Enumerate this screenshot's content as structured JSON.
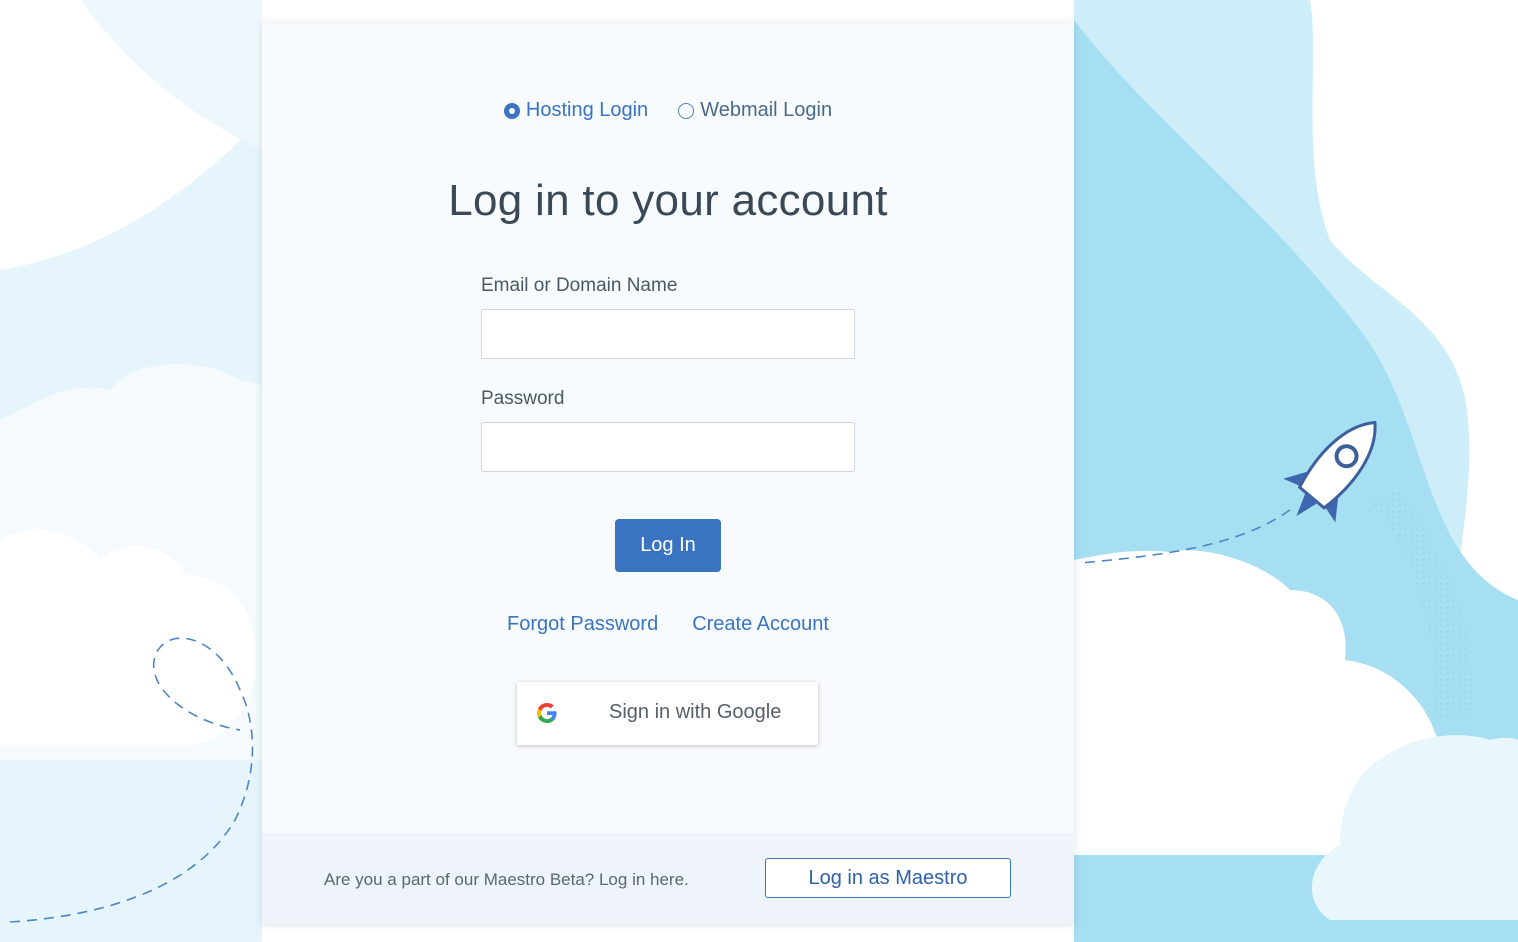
{
  "login_type": {
    "options": [
      {
        "label": "Hosting Login",
        "selected": true
      },
      {
        "label": "Webmail Login",
        "selected": false
      }
    ]
  },
  "form": {
    "title": "Log in to your account",
    "email_label": "Email or Domain Name",
    "email_value": "",
    "password_label": "Password",
    "password_value": "",
    "submit_label": "Log In"
  },
  "links": {
    "forgot_password": "Forgot Password",
    "create_account": "Create Account"
  },
  "google": {
    "label": "Sign in with Google",
    "icon": "google-g-icon"
  },
  "footer": {
    "prompt": "Are you a part of our Maestro Beta? Log in here.",
    "button_label": "Log in as Maestro"
  },
  "colors": {
    "accent": "#3a73c0",
    "sky": "#bfe6f5",
    "cloud": "#ffffff"
  }
}
